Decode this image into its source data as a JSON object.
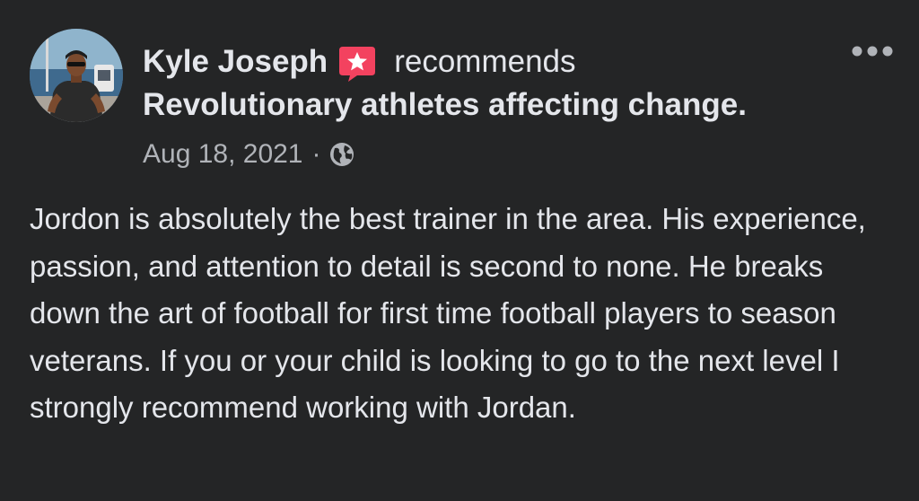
{
  "post": {
    "author": "Kyle Joseph",
    "action": "recommends",
    "page_name": "Revolutionary athletes affecting change.",
    "date": "Aug 18, 2021",
    "separator": "·",
    "privacy_icon": "globe-icon",
    "recommend_icon": "star-badge-icon",
    "more_icon": "more-horizontal-icon",
    "body": "Jordon is absolutely the best trainer in the area. His experience, passion, and attention to detail is second to none. He breaks down the art of football for first time football players to season veterans. If you or your child is looking to go to the next level I strongly recommend working with Jordan."
  },
  "colors": {
    "background": "#242526",
    "primary_text": "#e4e6eb",
    "secondary_text": "#b0b3b8",
    "recommend_badge": "#f3425f"
  }
}
